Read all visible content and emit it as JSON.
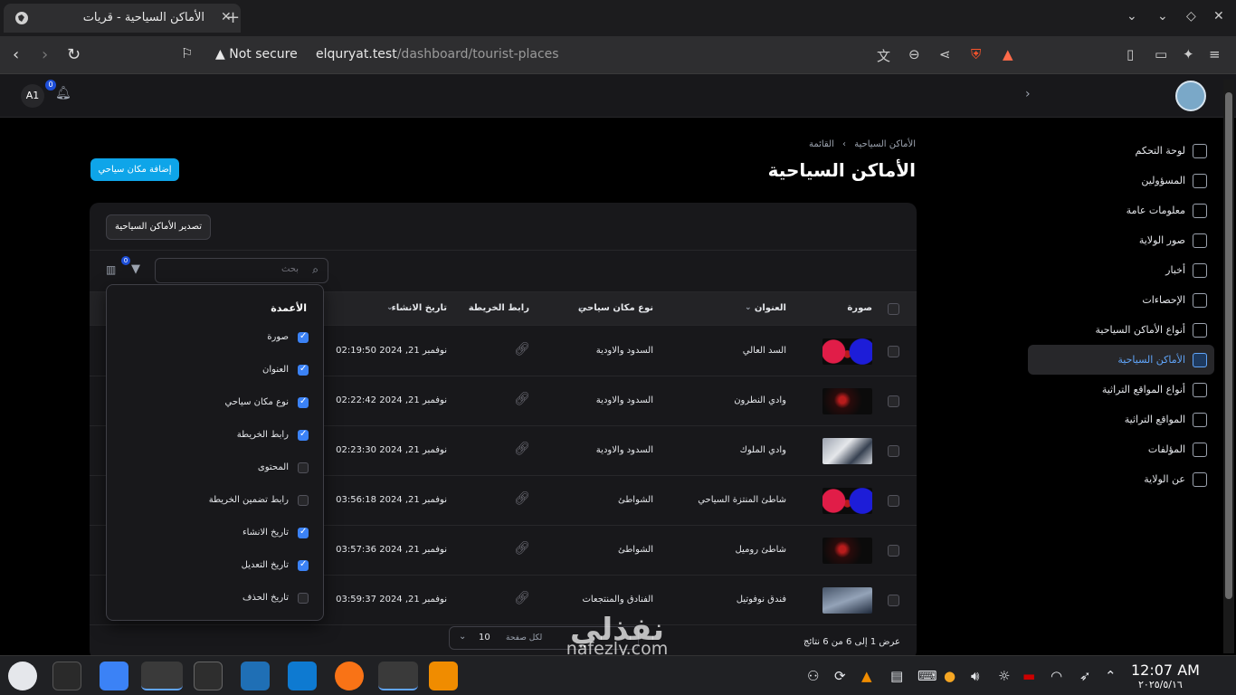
{
  "browser": {
    "tab_title": "الأماكن السياحية - قريات",
    "not_secure": "Not secure",
    "url_host": "elquryat.test",
    "url_path": "/dashboard/tourist-places"
  },
  "header": {
    "user_initials": "A1",
    "notifications_count": "0"
  },
  "sidebar": {
    "items": [
      {
        "label": "لوحة التحكم",
        "icon": "home-icon"
      },
      {
        "label": "المسؤولين",
        "icon": "users-icon"
      },
      {
        "label": "معلومات عامة",
        "icon": "info-icon"
      },
      {
        "label": "صور الولاية",
        "icon": "camera-icon"
      },
      {
        "label": "أخبار",
        "icon": "newspaper-icon"
      },
      {
        "label": "الإحصاءات",
        "icon": "chart-pie-icon"
      },
      {
        "label": "أنواع الأماكن السياحية",
        "icon": "list-icon"
      },
      {
        "label": "الأماكن السياحية",
        "icon": "building-icon",
        "active": true
      },
      {
        "label": "أنواع المواقع التراثية",
        "icon": "list-icon"
      },
      {
        "label": "المواقع التراثية",
        "icon": "landmark-icon"
      },
      {
        "label": "المؤلفات",
        "icon": "book-icon"
      },
      {
        "label": "عن الولاية",
        "icon": "question-icon"
      }
    ]
  },
  "page": {
    "breadcrumb_parent": "الأماكن السياحية",
    "breadcrumb_sep": "›",
    "breadcrumb_current": "القائمة",
    "title": "الأماكن السياحية",
    "add_button": "إضافة مكان سياحي",
    "export_button": "تصدير الأماكن السياحية",
    "search_placeholder": "بحث",
    "filter_count": "0"
  },
  "table": {
    "headers": {
      "image": "صورة",
      "title": "العنوان",
      "type": "نوع مكان سياحي",
      "map_link": "رابط الخريطة",
      "created_at": "تاريخ الانشاء"
    },
    "rows": [
      {
        "title": "السد العالي",
        "type": "السدود والاودية",
        "created": "نوفمبر 21, 2024 02:19:50",
        "thumb": "red-blue"
      },
      {
        "title": "وادي النطرون",
        "type": "السدود والاودية",
        "created": "نوفمبر 21, 2024 02:22:42",
        "thumb": "dark-red"
      },
      {
        "title": "وادي الملوك",
        "type": "السدود والاودية",
        "created": "نوفمبر 21, 2024 02:23:30",
        "thumb": "gray"
      },
      {
        "title": "شاطئ المنتزة السياحي",
        "type": "الشواطئ",
        "created": "نوفمبر 21, 2024 03:56:18",
        "thumb": "red-blue"
      },
      {
        "title": "شاطئ روميل",
        "type": "الشواطئ",
        "created": "نوفمبر 21, 2024 03:57:36",
        "thumb": "dark-red"
      },
      {
        "title": "فندق نوفوتيل",
        "type": "الفنادق والمنتجعات",
        "created": "نوفمبر 21, 2024 03:59:37",
        "thumb": "blue-gray"
      }
    ],
    "results_text": "عرض 1 إلى 6 من 6 نتائج",
    "per_page_label": "لكل صفحة",
    "per_page_value": "10"
  },
  "columns_panel": {
    "heading": "الأعمدة",
    "options": [
      {
        "label": "صورة",
        "checked": true
      },
      {
        "label": "العنوان",
        "checked": true
      },
      {
        "label": "نوع مكان سياحي",
        "checked": true
      },
      {
        "label": "رابط الخريطة",
        "checked": true
      },
      {
        "label": "المحتوى",
        "checked": false
      },
      {
        "label": "رابط تضمين الخريطة",
        "checked": false
      },
      {
        "label": "تاريخ الانشاء",
        "checked": true
      },
      {
        "label": "تاريخ التعديل",
        "checked": true
      },
      {
        "label": "تاريخ الحذف",
        "checked": false
      }
    ]
  },
  "watermark": {
    "arabic": "نفذلي",
    "latin": "nafezly.com"
  },
  "taskbar": {
    "time": "12:07 AM",
    "date": "٢٠٢٥/٥/١٦"
  },
  "colors": {
    "accent": "#0ea5e9",
    "active_link": "#60a5fa",
    "checkbox_on": "#3b82f6"
  }
}
